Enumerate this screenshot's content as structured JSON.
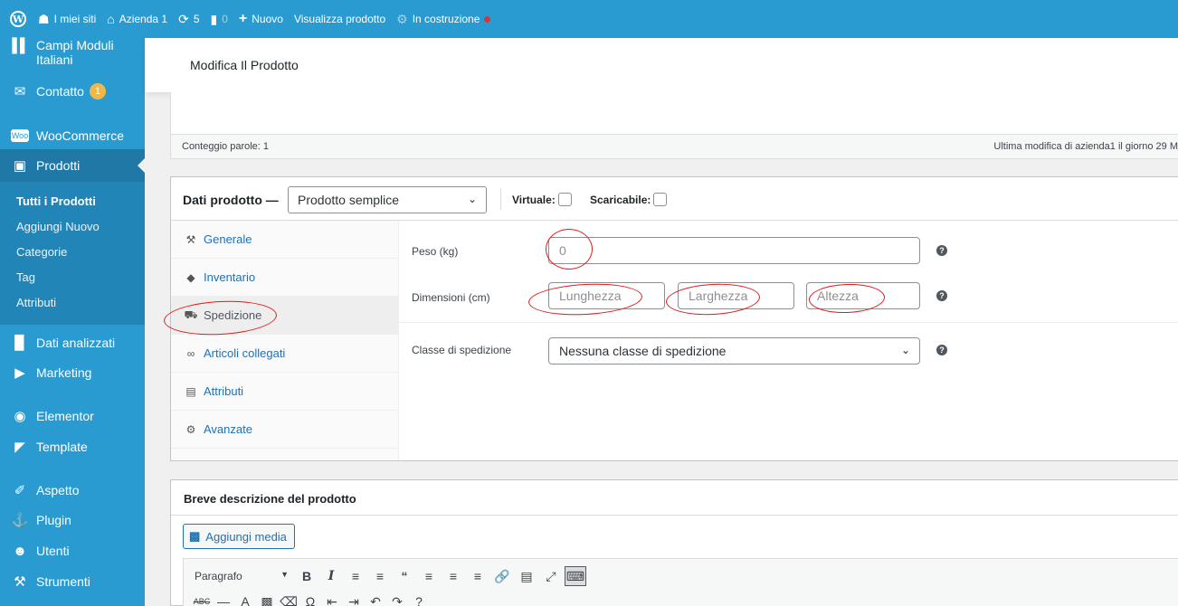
{
  "adminbar": {
    "wp_logo": "W",
    "my_sites": "I miei siti",
    "site_name": "Azienda 1",
    "updates_count": "5",
    "comments_count": "0",
    "new_label": "Nuovo",
    "view_product": "Visualizza prodotto",
    "under_construction": "In costruzione"
  },
  "sidebar": {
    "items": [
      {
        "label": "Campi Moduli Italiani",
        "icon": "plugin-block-icon"
      },
      {
        "label": "Contatto",
        "icon": "mail-icon",
        "badge": "1"
      },
      {
        "label": "WooCommerce",
        "icon": "woo-icon"
      },
      {
        "label": "Prodotti",
        "icon": "archive-icon"
      },
      {
        "label": "Dati analizzati",
        "icon": "chart-bar-icon"
      },
      {
        "label": "Marketing",
        "icon": "megaphone-icon"
      },
      {
        "label": "Elementor",
        "icon": "elementor-icon"
      },
      {
        "label": "Template",
        "icon": "folder-icon"
      },
      {
        "label": "Aspetto",
        "icon": "brush-icon"
      },
      {
        "label": "Plugin",
        "icon": "plug-icon"
      },
      {
        "label": "Utenti",
        "icon": "users-icon"
      },
      {
        "label": "Strumenti",
        "icon": "wrench-icon"
      }
    ],
    "submenu": [
      "Tutti i Prodotti",
      "Aggiungi Nuovo",
      "Categorie",
      "Tag",
      "Attributi"
    ]
  },
  "page": {
    "title": "Modifica Il Prodotto"
  },
  "statusbar": {
    "word_count": "Conteggio parole: 1",
    "last_edit": "Ultima modifica di azienda1 il giorno 29 M"
  },
  "product_data": {
    "title": "Dati prodotto —",
    "type_value": "Prodotto semplice",
    "virtual_label": "Virtuale:",
    "downloadable_label": "Scaricabile:",
    "tabs": [
      {
        "label": "Generale",
        "icon": "wrench-icon"
      },
      {
        "label": "Inventario",
        "icon": "tag-icon"
      },
      {
        "label": "Spedizione",
        "icon": "truck-icon"
      },
      {
        "label": "Articoli collegati",
        "icon": "link-icon"
      },
      {
        "label": "Attributi",
        "icon": "list-icon"
      },
      {
        "label": "Avanzate",
        "icon": "gear-icon"
      }
    ],
    "active_tab": "Spedizione",
    "weight_label": "Peso (kg)",
    "weight_placeholder": "0",
    "dimensions_label": "Dimensioni (cm)",
    "length_placeholder": "Lunghezza",
    "width_placeholder": "Larghezza",
    "height_placeholder": "Altezza",
    "shipping_class_label": "Classe di spedizione",
    "shipping_class_value": "Nessuna classe di spedizione"
  },
  "short_description": {
    "title": "Breve descrizione del prodotto",
    "add_media": "Aggiungi media",
    "format_value": "Paragrafo"
  },
  "colors": {
    "sidebar_bg": "#2a9bd0",
    "link": "#2271b1",
    "annotation": "#e01b1b"
  }
}
